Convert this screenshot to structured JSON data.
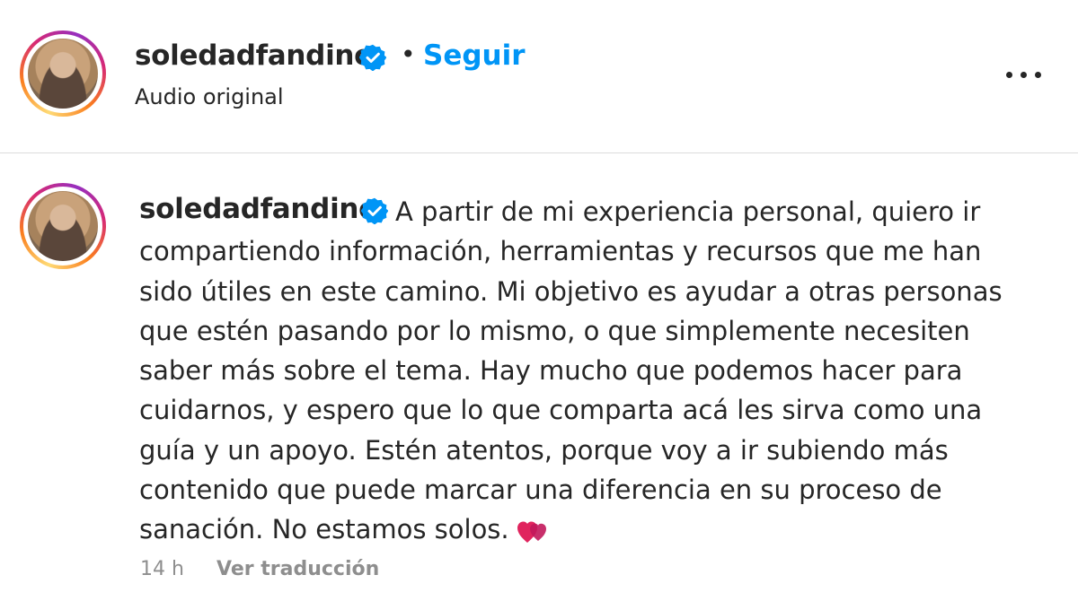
{
  "header": {
    "username": "soledadfandino",
    "separator": "•",
    "follow_label": "Seguir",
    "subtitle": "Audio original",
    "verified_icon": "verified-badge-icon",
    "more_icon": "more-options-icon"
  },
  "comment": {
    "username": "soledadfandino",
    "caption": "A partir de mi experiencia personal, quiero ir compartiendo información, herramientas y recursos que me han sido útiles en este camino. Mi objetivo es ayudar a otras personas que estén pasando por lo mismo, o que simplemente necesiten saber más sobre el tema. Hay mucho que podemos hacer para cuidarnos, y espero que lo que comparta acá les sirva como una guía y un apoyo. Estén atentos, porque voy a ir subiendo más contenido que puede marcar una diferencia en su proceso de sanación. No estamos solos.",
    "emoji_icon": "two-hearts-icon",
    "timestamp": "14 h",
    "translate_label": "Ver traducción"
  },
  "colors": {
    "accent": "#0095f6",
    "text": "#262626",
    "muted": "#8e8e8e",
    "divider": "#dbdbdb"
  }
}
